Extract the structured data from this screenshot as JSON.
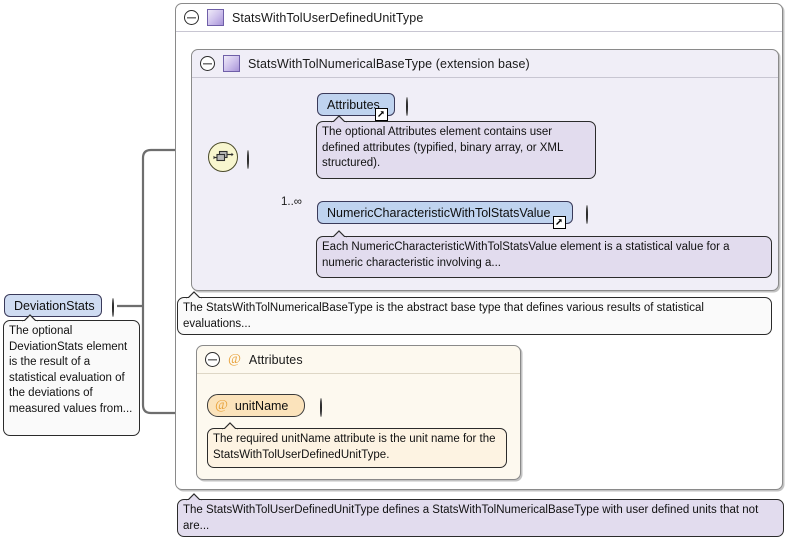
{
  "diagram": {
    "kind": "xsd-schema-diagram",
    "root_element": {
      "name": "DeviationStats",
      "toggle": "minus",
      "annotation": "The optional DeviationStats element is the result of a statistical evaluation of the deviations of measured values from..."
    },
    "outer_type": {
      "name": "StatsWithTolUserDefinedUnitType",
      "icon": "complextype-icon",
      "toggle": "minus",
      "annotation": "The StatsWithTolUserDefinedUnitType defines a StatsWithTolNumericalBaseType with user defined units that not are..."
    },
    "inner_type": {
      "name": "StatsWithTolNumericalBaseType (extension base)",
      "icon": "complextype-icon",
      "toggle": "minus",
      "annotation": "The StatsWithTolNumericalBaseType is the abstract base type that defines various results of statistical evaluations...",
      "compositor": "sequence",
      "compositor_toggle": "minus",
      "children": [
        {
          "name": "Attributes",
          "occurs": "",
          "expand": "plus",
          "reference_badge": true,
          "annotation": "The optional Attributes element contains user defined attributes (typified, binary array, or XML structured)."
        },
        {
          "name": "NumericCharacteristicWithTolStatsValue",
          "occurs": "1..∞",
          "expand": "plus",
          "reference_badge": true,
          "annotation": "Each NumericCharacteristicWithTolStatsValue element is a statistical value for a numeric characteristic involving a..."
        }
      ]
    },
    "attribute_group": {
      "name": "Attributes",
      "icon": "at-icon",
      "toggle": "minus",
      "attributes": [
        {
          "name": "unitName",
          "icon": "at-icon",
          "expand": "plus",
          "annotation": "The required unitName attribute is the unit name for the StatsWithTolUserDefinedUnitType."
        }
      ]
    },
    "colors": {
      "element_fill": "#bfd3ef",
      "attribute_fill": "#fbe3bb",
      "compositor_fill": "#f8f6cf",
      "inner_container_fill": "#f0eef7",
      "attr_container_fill": "#fdf9ef",
      "annotation_purple": "#e2dcee",
      "annotation_white": "#fafafa",
      "annotation_cream": "#fdf3e2",
      "connector_line": "#6e6e6e",
      "type_glyph": "#a894d8",
      "at_glyph": "#e8a33d"
    }
  }
}
